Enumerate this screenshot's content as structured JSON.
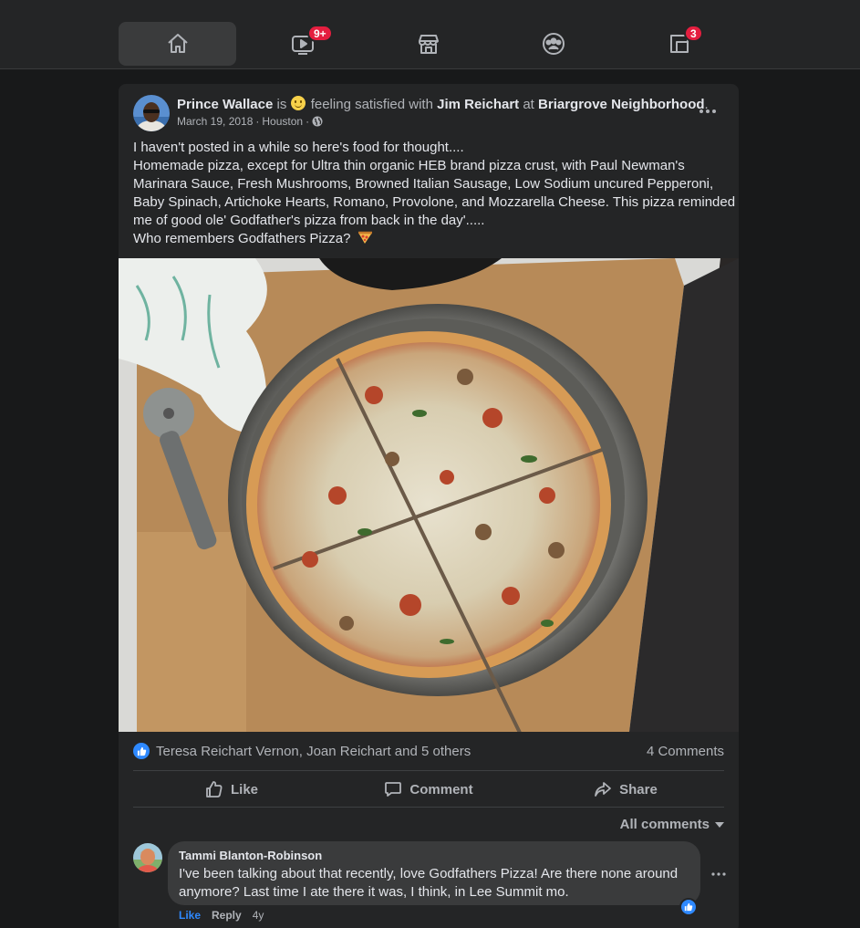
{
  "nav": {
    "tabs": [
      {
        "name": "home",
        "icon": "home-icon",
        "active": true
      },
      {
        "name": "watch",
        "icon": "watch-icon",
        "badge": "9+"
      },
      {
        "name": "marketplace",
        "icon": "marketplace-icon"
      },
      {
        "name": "groups",
        "icon": "groups-icon"
      },
      {
        "name": "gaming",
        "icon": "gaming-icon",
        "badge": "3"
      }
    ]
  },
  "post": {
    "author": "Prince Wallace",
    "connector_is": "is",
    "feeling_text": "feeling satisfied with",
    "tagged": "Jim Reichart",
    "connector_at": "at",
    "place": "Briargrove Neighborhood",
    "date": "March 19, 2018",
    "location": "Houston",
    "audience_icon": "globe-icon",
    "text_lines": [
      "I haven't posted in a while so here's food for thought....",
      "Homemade pizza, except for Ultra thin organic HEB brand pizza crust, with Paul Newman's",
      "Marinara Sauce, Fresh Mushrooms, Browned Italian Sausage, Low Sodium uncured Pepperoni,",
      "Baby Spinach, Artichoke Hearts, Romano, Provolone, and Mozzarella Cheese. This pizza reminded",
      "me of good ole' Godfather's pizza from back in the day'.....",
      "Who remembers Godfathers Pizza?"
    ],
    "reactions_text": "Teresa Reichart Vernon, Joan Reichart and 5 others",
    "comments_count": "4 Comments",
    "actions": {
      "like": "Like",
      "comment": "Comment",
      "share": "Share"
    },
    "all_comments": "All comments"
  },
  "comment": {
    "author": "Tammi Blanton-Robinson",
    "text_lines": [
      "I've been talking about that recently, love Godfathers Pizza! Are there none around",
      "anymore? Last time I ate there it was, I think, in Lee Summit mo."
    ],
    "like": "Like",
    "reply": "Reply",
    "time": "4y"
  },
  "colors": {
    "background": "#18191a",
    "card": "#242526",
    "accent_blue": "#2e89ff",
    "badge_red": "#e41e3f"
  }
}
